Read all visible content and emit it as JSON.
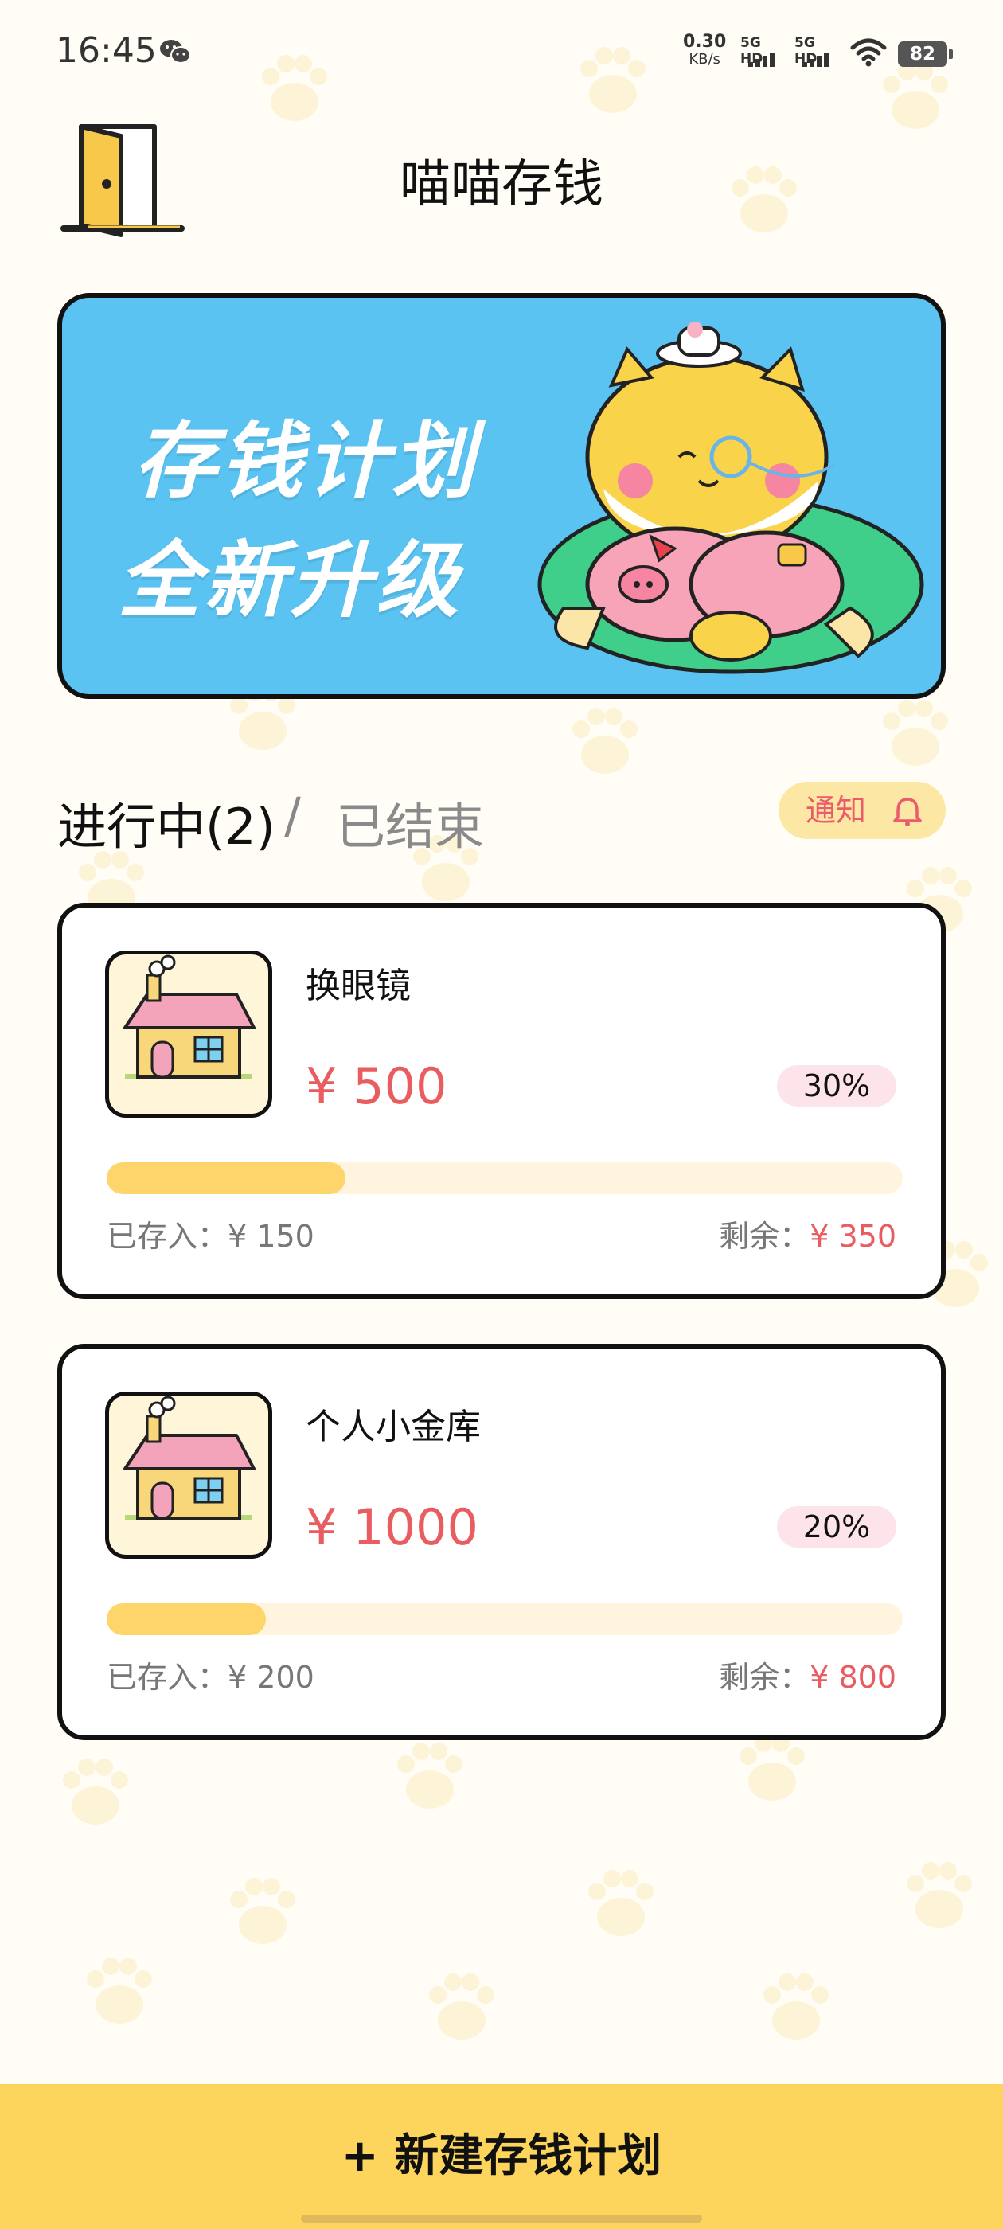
{
  "status_bar": {
    "time": "16:45",
    "net_speed": "0.30",
    "net_unit": "KB/s",
    "signal1_label": "5G HD",
    "signal2_label": "5G HD",
    "battery": "82",
    "icons": [
      "wechat-icon",
      "signal-icon",
      "wifi-icon",
      "battery-icon"
    ]
  },
  "header": {
    "title": "喵喵存钱",
    "exit_icon": "door-icon"
  },
  "banner": {
    "line1": "存钱计划",
    "line2": "全新升级",
    "bg_color": "#5bc3f2"
  },
  "tabs": {
    "active": "进行中(2)",
    "separator": "/",
    "inactive": "已结束"
  },
  "notify": {
    "label": "通知",
    "icon": "bell-icon"
  },
  "plans": [
    {
      "name": "换眼镜",
      "amount": "¥ 500",
      "percent": "30%",
      "progress": 0.3,
      "saved_label": "已存入：",
      "saved_value": "¥ 150",
      "remain_label": "剩余：",
      "remain_value": "¥ 350",
      "thumb_icon": "house-icon"
    },
    {
      "name": "个人小金库",
      "amount": "¥ 1000",
      "percent": "20%",
      "progress": 0.2,
      "saved_label": "已存入：",
      "saved_value": "¥ 200",
      "remain_label": "剩余：",
      "remain_value": "¥ 800",
      "thumb_icon": "house-icon"
    }
  ],
  "create_button": {
    "label": "+ 新建存钱计划",
    "color": "#fdd45c"
  },
  "colors": {
    "accent_red": "#e95c60",
    "progress_yellow": "#fdd56a",
    "notify_bg": "#fde7a5",
    "percent_bg": "#fde3ea"
  }
}
